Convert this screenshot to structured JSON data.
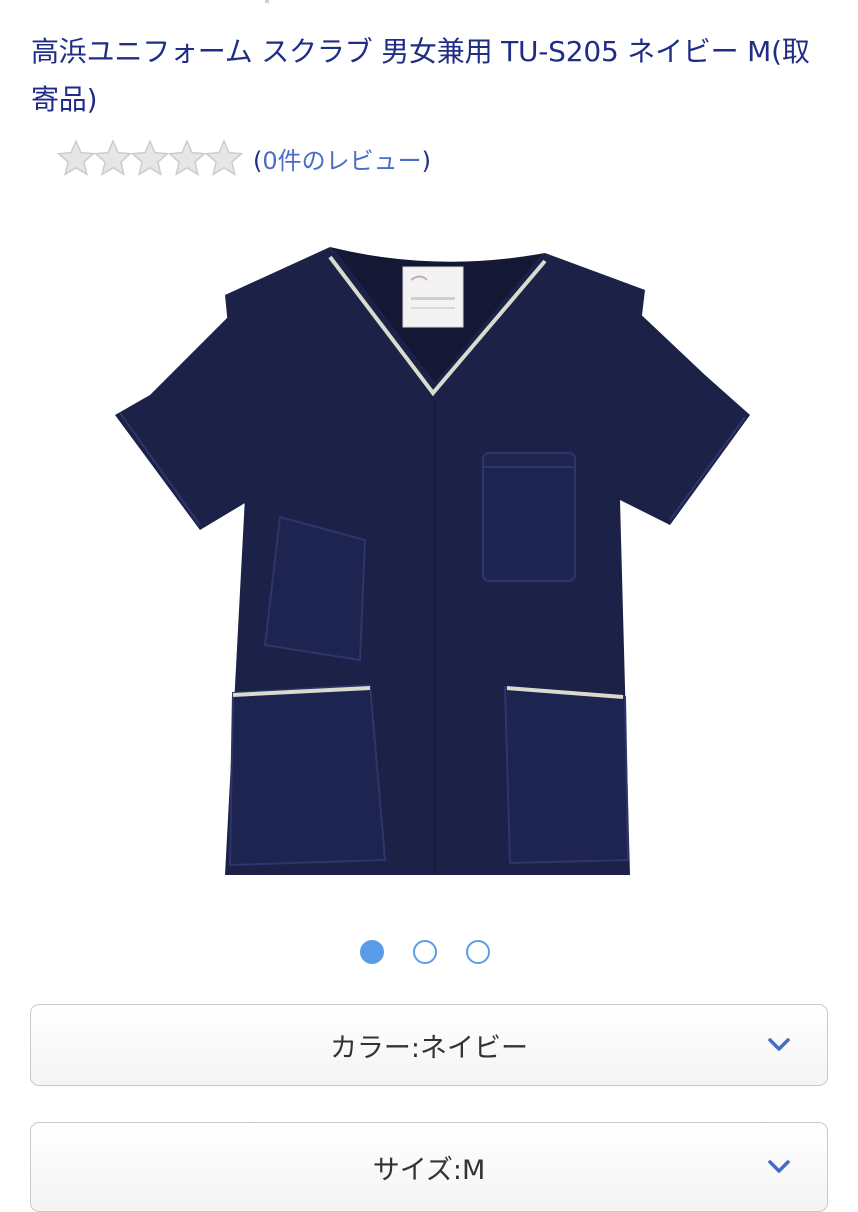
{
  "product": {
    "title": "高浜ユニフォーム スクラブ 男女兼用 TU-S205 ネイビー M(取寄品)",
    "rating": 0,
    "rating_max": 5,
    "review_open_paren": "(",
    "review_link": "0件のレビュー",
    "review_close_paren": ")",
    "image_icon": "navy-scrub-top-image"
  },
  "carousel": {
    "total": 3,
    "active_index": 0
  },
  "options": {
    "color_label": "カラー:ネイビー",
    "size_label": "サイズ:M",
    "chevron_icon": "chevron-down-icon"
  },
  "colors": {
    "title_text": "#1f2d86",
    "link": "#4a6ec8",
    "dot_active": "#5b9ce8",
    "star_empty": "#d9d9d9",
    "garment_navy": "#1c2147"
  }
}
